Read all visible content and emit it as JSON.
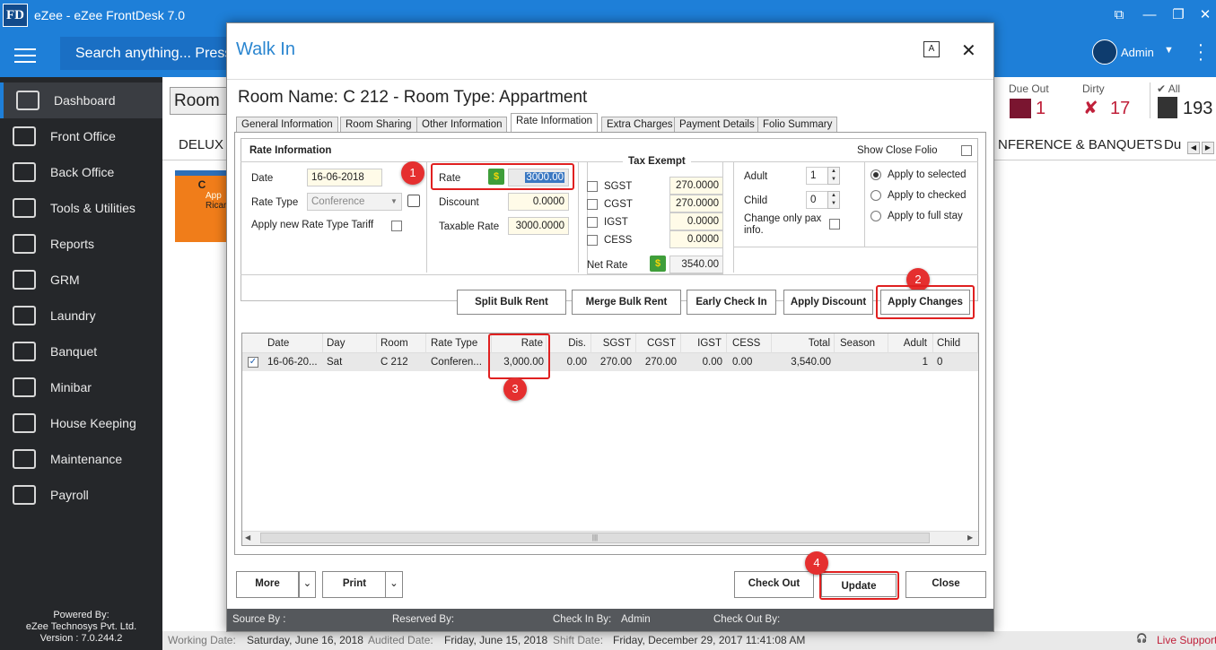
{
  "app": {
    "logo": "FD",
    "title": "eZee - eZee FrontDesk 7.0",
    "search_placeholder": "Search anything... Press",
    "user": "Admin"
  },
  "sidebar": {
    "items": [
      {
        "label": "Dashboard",
        "icon": "chart-icon"
      },
      {
        "label": "Front Office",
        "icon": "bell-icon"
      },
      {
        "label": "Back Office",
        "icon": "building-icon"
      },
      {
        "label": "Tools & Utilities",
        "icon": "tools-icon"
      },
      {
        "label": "Reports",
        "icon": "report-icon"
      },
      {
        "label": "GRM",
        "icon": "grm-icon"
      },
      {
        "label": "Laundry",
        "icon": "iron-icon"
      },
      {
        "label": "Banquet",
        "icon": "banquet-icon"
      },
      {
        "label": "Minibar",
        "icon": "fridge-icon"
      },
      {
        "label": "House Keeping",
        "icon": "housekeeping-icon"
      },
      {
        "label": "Maintenance",
        "icon": "maintenance-icon"
      },
      {
        "label": "Payroll",
        "icon": "payroll-icon"
      }
    ],
    "powered": [
      "Powered By:",
      "eZee Technosys Pvt. Ltd.",
      "Version : 7.0.244.2"
    ]
  },
  "background": {
    "room_view": "Room V",
    "tab_delux": "DELUX",
    "tab_conference": "NFERENCE & BANQUETS",
    "tab_du": "Du",
    "card_letter": "C",
    "card_line1": "App",
    "card_line2": "Ricar",
    "stats": [
      {
        "label": "Due Out",
        "value": "1"
      },
      {
        "label": "Dirty",
        "value": "17"
      },
      {
        "label": "All",
        "value": "193"
      }
    ],
    "workbar": {
      "working_label": "Working Date:",
      "working": "Saturday, June 16, 2018",
      "audited_label": "Audited Date:",
      "audited": "Friday, June 15, 2018",
      "shift_label": "Shift Date:",
      "shift": "Friday, December 29, 2017 11:41:08 AM",
      "live_support": "Live Support"
    }
  },
  "dialog": {
    "title": "Walk In",
    "room_heading": "Room Name: C 212 - Room Type: Appartment",
    "tabs": [
      "General Information",
      "Room Sharing",
      "Other Information",
      "Rate Information",
      "Extra Charges",
      "Payment Details",
      "Folio Summary"
    ],
    "rate_info": {
      "heading": "Rate Information",
      "show_close_folio": "Show Close Folio",
      "date_label": "Date",
      "date": "16-06-2018",
      "rate_type_label": "Rate Type",
      "rate_type": "Conference Rate",
      "apply_new_label": "Apply new Rate Type Tariff",
      "rate_label": "Rate",
      "rate": "3000.00",
      "discount_label": "Discount",
      "discount": "0.0000",
      "taxable_label": "Taxable Rate",
      "taxable": "3000.0000",
      "tax_exempt": "Tax Exempt",
      "taxes": [
        {
          "name": "SGST",
          "value": "270.0000"
        },
        {
          "name": "CGST",
          "value": "270.0000"
        },
        {
          "name": "IGST",
          "value": "0.0000"
        },
        {
          "name": "CESS",
          "value": "0.0000"
        }
      ],
      "net_rate_label": "Net Rate",
      "net_rate": "3540.00",
      "adult_label": "Adult",
      "adult": "1",
      "child_label": "Child",
      "child": "0",
      "change_pax_label": "Change only pax info.",
      "apply_options": [
        "Apply to selected",
        "Apply to checked",
        "Apply to full stay"
      ]
    },
    "buttons": [
      "Split Bulk Rent",
      "Merge Bulk Rent",
      "Early Check In",
      "Apply Discount",
      "Apply Changes"
    ],
    "grid": {
      "columns": [
        "Date",
        "Day",
        "Room",
        "Rate Type",
        "Rate",
        "Dis.",
        "SGST",
        "CGST",
        "IGST",
        "CESS",
        "Total",
        "Season",
        "Adult",
        "Child"
      ],
      "rows": [
        [
          "16-06-20...",
          "Sat",
          "C 212",
          "Conferen...",
          "3,000.00",
          "0.00",
          "270.00",
          "270.00",
          "0.00",
          "0.00",
          "3,540.00",
          "",
          "1",
          "0"
        ]
      ]
    },
    "footer": {
      "more": "More",
      "print": "Print",
      "check_out": "Check Out",
      "update": "Update",
      "close": "Close"
    },
    "status": {
      "source": "Source By :",
      "reserved": "Reserved By:",
      "checkin": "Check In By:",
      "checkin_val": "Admin",
      "checkout": "Check Out By:"
    },
    "annotations": [
      "1",
      "2",
      "3",
      "4"
    ]
  }
}
